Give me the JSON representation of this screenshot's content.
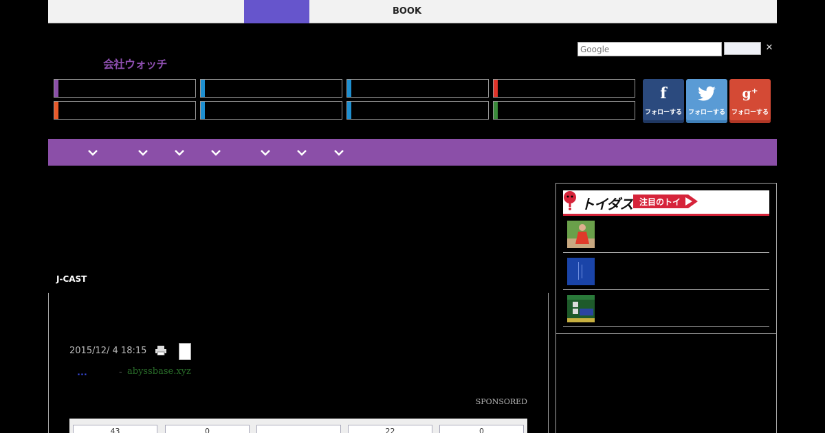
{
  "topbar": {
    "book_label": "BOOK"
  },
  "search": {
    "placeholder": "Google",
    "close_glyph": "✕"
  },
  "logo": {
    "text": "会社ウォッチ"
  },
  "categories": [
    {
      "accent": "#8b4fa8"
    },
    {
      "accent": "#1e8fd0"
    },
    {
      "accent": "#1e8fd0"
    },
    {
      "accent": "#e0342a"
    },
    {
      "accent": "#e85a2a"
    },
    {
      "accent": "#1e8fd0"
    },
    {
      "accent": "#1e8fd0"
    },
    {
      "accent": "#3a8a3a"
    }
  ],
  "social": [
    {
      "icon": "facebook-icon",
      "glyph": "f",
      "label": "フォローする"
    },
    {
      "icon": "twitter-icon",
      "glyph": "t",
      "label": "フォローする"
    },
    {
      "icon": "google-plus-icon",
      "glyph": "g⁺",
      "label": "フォローする"
    }
  ],
  "nav": {
    "color": "#8b4fa8",
    "dropdown_count": 7
  },
  "article": {
    "source": "J-CAST",
    "date": "2015/12/ 4 18:15",
    "ad_dots": "...",
    "ad_dash": "-",
    "ad_domain": "abyssbase.xyz",
    "sponsored": "SPONSORED",
    "counts": [
      "43",
      "0",
      "",
      "22",
      "0"
    ]
  },
  "sidebar": {
    "brand": "トイダス",
    "badge": "注目のトイ",
    "items": [
      {
        "thumb": "red-dress-photo"
      },
      {
        "thumb": "blue-book-cover"
      },
      {
        "thumb": "railway-quiz-cover"
      }
    ]
  }
}
